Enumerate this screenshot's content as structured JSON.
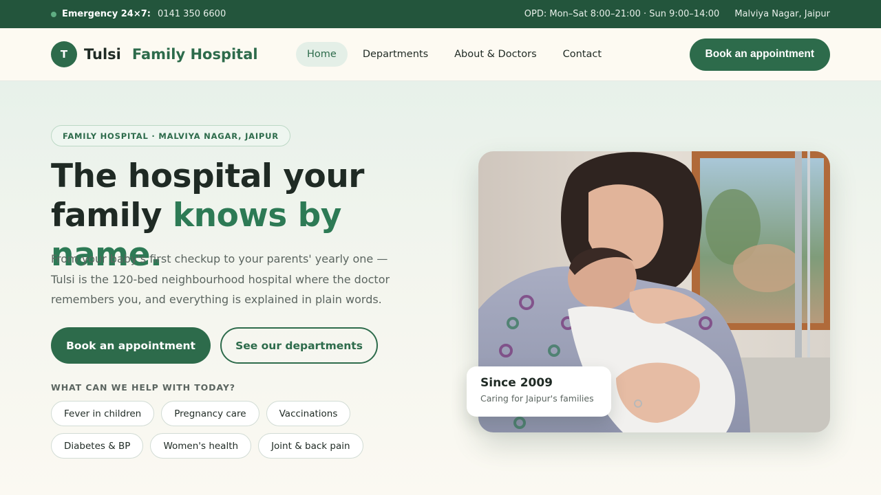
{
  "topbar": {
    "emergency_label": "Emergency 24×7:",
    "emergency_phone": "0141 350 6600",
    "opd_hours": "OPD: Mon–Sat 8:00–21:00 · Sun 9:00–14:00",
    "location": "Malviya Nagar, Jaipur"
  },
  "header": {
    "logo_letter": "T",
    "brand_name": "Tulsi",
    "brand_sub": "Family Hospital",
    "nav": [
      "Home",
      "Departments",
      "About & Doctors",
      "Contact"
    ],
    "active_nav": "Home",
    "cta": "Book an appointment"
  },
  "hero": {
    "kicker": "FAMILY HOSPITAL · MALVIYA NAGAR, JAIPUR",
    "headline_line1": "The hospital your",
    "headline_line2_plain": "family",
    "headline_line2_accent": "knows by name.",
    "lead": "From your baby's first checkup to your parents' yearly one — Tulsi is the 120-bed neighbourhood hospital where the doctor remembers you, and everything is explained in plain words.",
    "primary_button": "Book an appointment",
    "secondary_button": "See our departments",
    "help_label": "WHAT CAN WE HELP WITH TODAY?",
    "chips": [
      "Fever in children",
      "Pregnancy care",
      "Vaccinations",
      "Diabetes & BP",
      "Women's health",
      "Joint & back pain"
    ],
    "badge_title": "Since 2009",
    "badge_subtitle": "Caring for Jaipur's families"
  },
  "colors": {
    "brand_green": "#2d6b4b",
    "topbar_green": "#23553c",
    "accent_green": "#2d7a55",
    "background": "#fbf9f2"
  }
}
